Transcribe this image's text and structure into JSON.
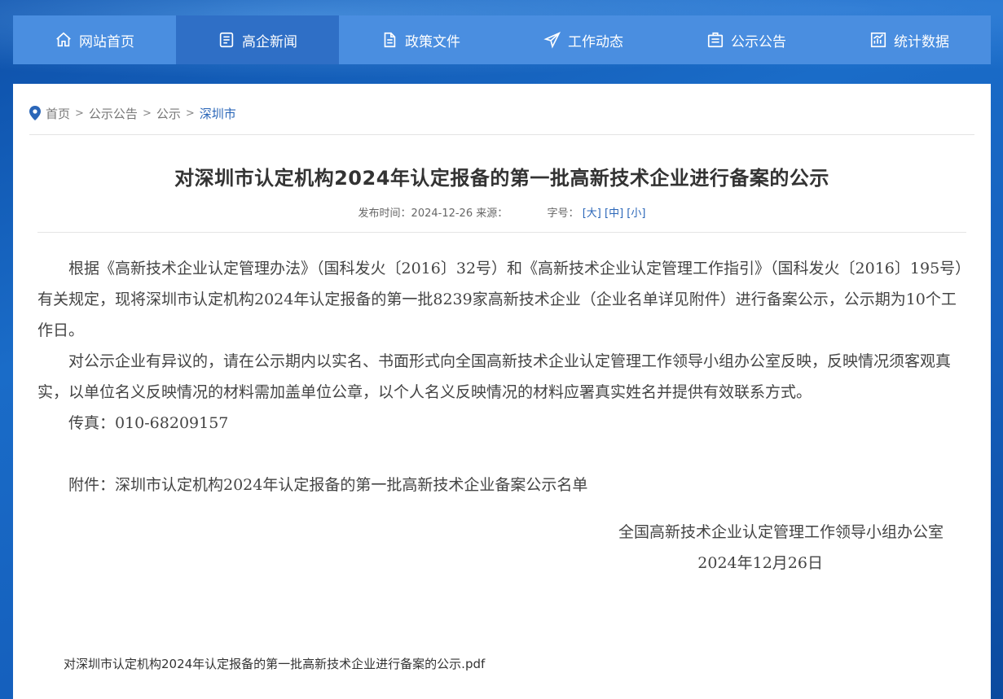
{
  "nav": {
    "items": [
      {
        "label": "网站首页",
        "icon": "home-icon"
      },
      {
        "label": "高企新闻",
        "icon": "news-icon"
      },
      {
        "label": "政策文件",
        "icon": "document-icon"
      },
      {
        "label": "工作动态",
        "icon": "paper-plane-icon"
      },
      {
        "label": "公示公告",
        "icon": "notice-icon"
      },
      {
        "label": "统计数据",
        "icon": "chart-icon"
      }
    ],
    "active_index": 1
  },
  "breadcrumb": {
    "home": "首页",
    "level1": "公示公告",
    "level2": "公示",
    "current": "深圳市",
    "separator": ">"
  },
  "article": {
    "title": "对深圳市认定机构2024年认定报备的第一批高新技术企业进行备案的公示",
    "publish_label": "发布时间：",
    "publish_date": "2024-12-26",
    "source_label": "来源：",
    "font_size_label": "字号：",
    "font_large": "[大]",
    "font_medium": "[中]",
    "font_small": "[小]",
    "paragraph1": "根据《高新技术企业认定管理办法》（国科发火〔2016〕32号）和《高新技术企业认定管理工作指引》（国科发火〔2016〕195号）有关规定，现将深圳市认定机构2024年认定报备的第一批8239家高新技术企业（企业名单详见附件）进行备案公示，公示期为10个工作日。",
    "paragraph2": "对公示企业有异议的，请在公示期内以实名、书面形式向全国高新技术企业认定管理工作领导小组办公室反映，反映情况须客观真实，以单位名义反映情况的材料需加盖单位公章，以个人名义反映情况的材料应署真实姓名并提供有效联系方式。",
    "fax": "传真：010-68209157",
    "attachment_note": "附件：深圳市认定机构2024年认定报备的第一批高新技术企业备案公示名单",
    "signature_org": "全国高新技术企业认定管理工作领导小组办公室",
    "signature_date": "2024年12月26日",
    "attachment_file": "对深圳市认定机构2024年认定报备的第一批高新技术企业进行备案的公示.pdf"
  },
  "colors": {
    "nav_bg": "#4a8ee0",
    "nav_active": "#2f6fc6",
    "link_blue": "#2a66b8",
    "page_bg": "#1560bd"
  }
}
